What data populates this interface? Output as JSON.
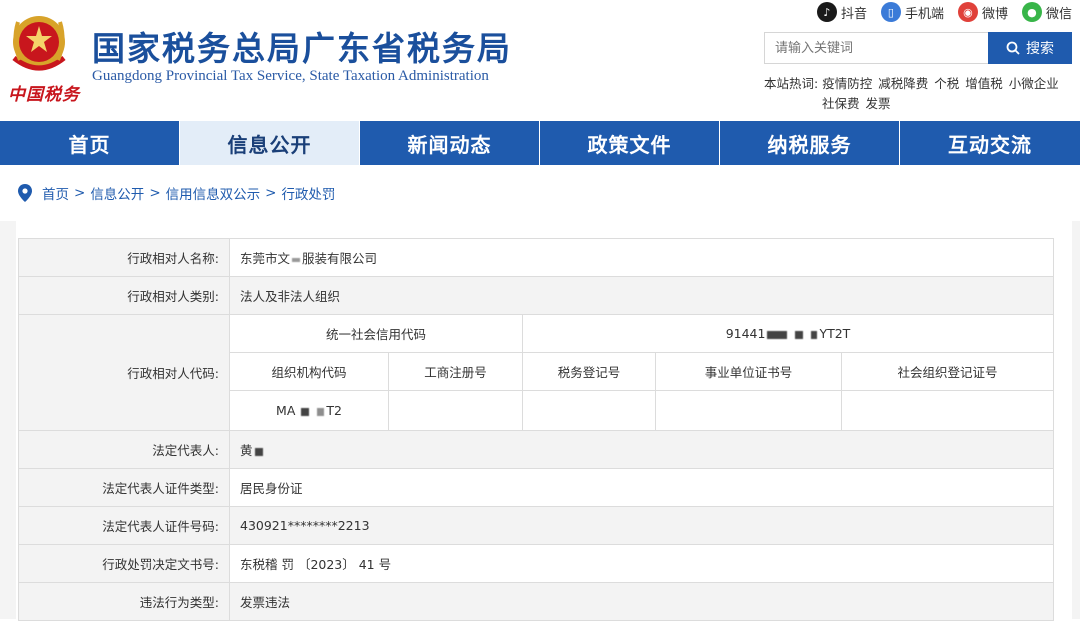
{
  "header": {
    "title_cn": "国家税务总局广东省税务局",
    "title_en": "Guangdong Provincial Tax Service, State Taxation Administration",
    "china_tax_logo": "中国税务",
    "social": [
      {
        "icon": "douyin-icon",
        "label": "抖音",
        "color": "#1a1a1a"
      },
      {
        "icon": "mobile-icon",
        "label": "手机端",
        "color": "#3b7bd8"
      },
      {
        "icon": "weibo-icon",
        "label": "微博",
        "color": "#e0413a"
      },
      {
        "icon": "wechat-icon",
        "label": "微信",
        "color": "#38b549"
      }
    ],
    "search": {
      "placeholder": "请输入关键词",
      "button": "搜索"
    },
    "hot": {
      "label": "本站热词:",
      "items": [
        "疫情防控",
        "减税降费",
        "个税",
        "增值税",
        "小微企业",
        "社保费",
        "发票"
      ]
    }
  },
  "nav": {
    "items": [
      "首页",
      "信息公开",
      "新闻动态",
      "政策文件",
      "纳税服务",
      "互动交流"
    ],
    "active_index": 1
  },
  "breadcrumb": {
    "items": [
      "首页",
      "信息公开",
      "信用信息双公示",
      "行政处罚"
    ],
    "separator": ">"
  },
  "record": {
    "name_label": "行政相对人名称:",
    "name_value": "东莞市文",
    "name_value_suffix": "服装有限公司",
    "type_label": "行政相对人类别:",
    "type_value": "法人及非法人组织",
    "code_label": "行政相对人代码:",
    "uscc_label": "统一社会信用代码",
    "uscc_value_prefix": "91441",
    "uscc_value_suffix": "YT2T",
    "org_code_label": "组织机构代码",
    "biz_reg_label": "工商注册号",
    "tax_reg_label": "税务登记号",
    "institution_label": "事业单位证书号",
    "social_org_label": "社会组织登记证号",
    "org_code_prefix": "MA",
    "org_code_suffix": "T2",
    "legal_rep_label": "法定代表人:",
    "legal_rep_value": "黄",
    "id_type_label": "法定代表人证件类型:",
    "id_type_value": "居民身份证",
    "id_no_label": "法定代表人证件号码:",
    "id_no_value": "430921********2213",
    "decision_label": "行政处罚决定文书号:",
    "decision_value": "东税稽 罚 〔2023〕 41 号",
    "violation_label": "违法行为类型:",
    "violation_value": "发票违法"
  }
}
